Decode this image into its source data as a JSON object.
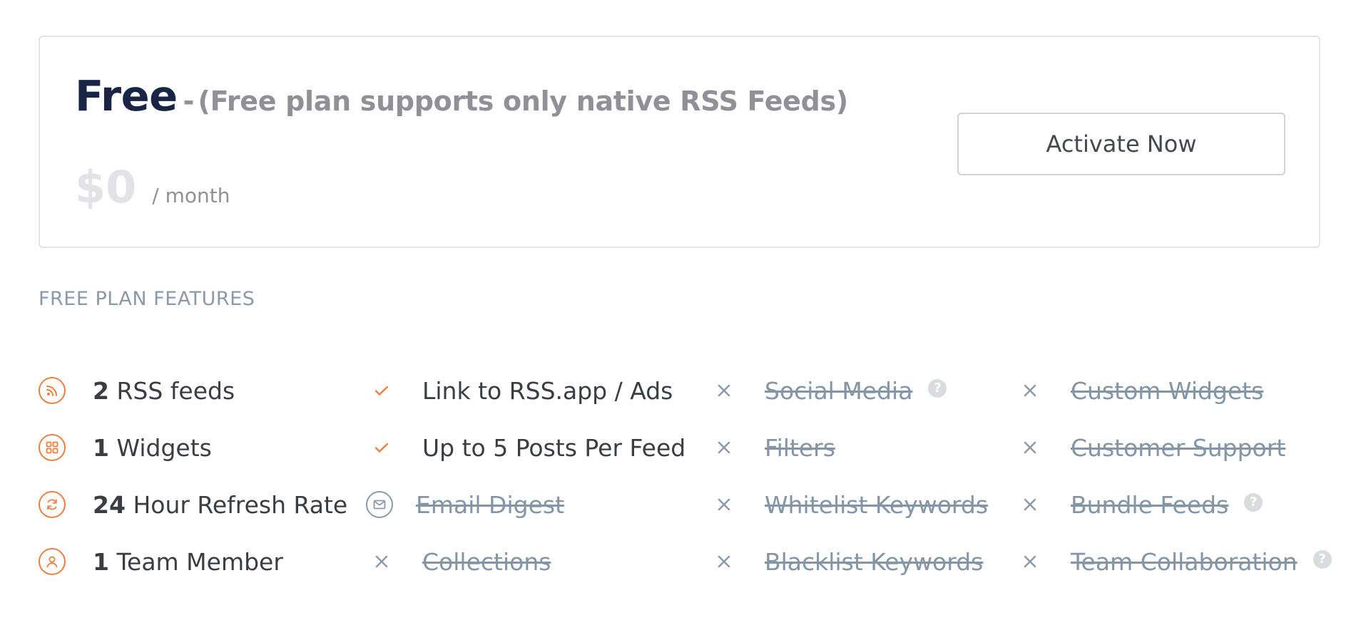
{
  "plan": {
    "name": "Free",
    "separator": "-",
    "description": "(Free plan supports only native RSS Feeds)",
    "price": "$0",
    "period": "/ month",
    "activate_label": "Activate Now"
  },
  "features_heading": "FREE PLAN FEATURES",
  "limits": [
    {
      "icon": "rss-icon",
      "count": "2",
      "label": "RSS feeds"
    },
    {
      "icon": "widgets-icon",
      "count": "1",
      "label": "Widgets"
    },
    {
      "icon": "refresh-icon",
      "count": "24",
      "label": "Hour Refresh Rate"
    },
    {
      "icon": "user-icon",
      "count": "1",
      "label": "Team Member"
    }
  ],
  "features": [
    {
      "label": "Link to RSS.app / Ads",
      "included": true,
      "icon": "check-icon"
    },
    {
      "label": "Up to 5 Posts Per Feed",
      "included": true,
      "icon": "check-icon"
    },
    {
      "label": "Email Digest",
      "included": false,
      "icon": "mail-icon"
    },
    {
      "label": "Collections",
      "included": false,
      "icon": "x-icon"
    },
    {
      "label": "Social Media",
      "included": false,
      "icon": "x-icon",
      "help": true
    },
    {
      "label": "Filters",
      "included": false,
      "icon": "x-icon"
    },
    {
      "label": "Whitelist Keywords",
      "included": false,
      "icon": "x-icon"
    },
    {
      "label": "Blacklist Keywords",
      "included": false,
      "icon": "x-icon"
    },
    {
      "label": "Custom Widgets",
      "included": false,
      "icon": "x-icon"
    },
    {
      "label": "Customer Support",
      "included": false,
      "icon": "x-icon"
    },
    {
      "label": "Bundle Feeds",
      "included": false,
      "icon": "x-icon",
      "help": true
    },
    {
      "label": "Team Collaboration",
      "included": false,
      "icon": "x-icon",
      "help": true
    }
  ],
  "help_glyph": "?",
  "colors": {
    "accent": "#ef7f3e",
    "title": "#1a2546",
    "muted": "#8f9196",
    "disabled": "#8496a6",
    "border": "#e1e3e6"
  }
}
